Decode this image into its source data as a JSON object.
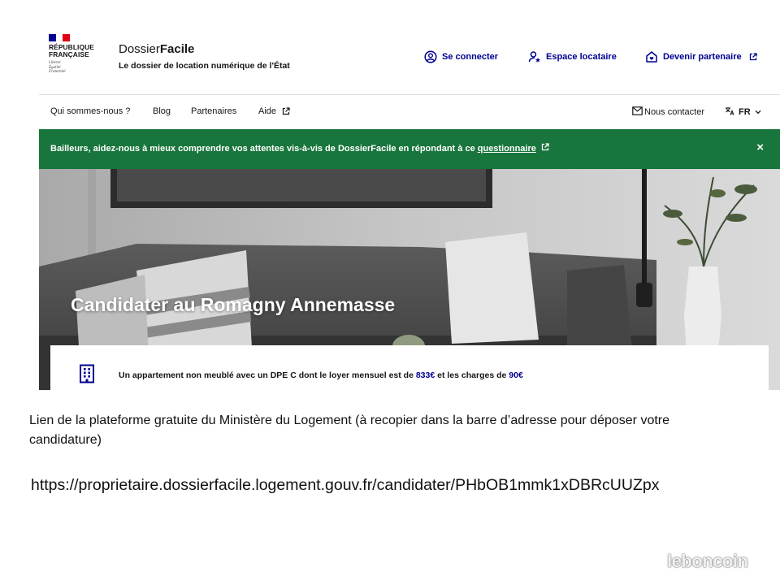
{
  "header": {
    "republique": "RÉPUBLIQUE FRANÇAISE",
    "devise": [
      "Liberté",
      "Égalité",
      "Fraternité"
    ],
    "brand_prefix": "Dossier",
    "brand_bold": "Facile",
    "tagline": "Le dossier de location numérique de l'État",
    "links": {
      "login": "Se connecter",
      "tenant_space": "Espace locataire",
      "partner": "Devenir partenaire"
    }
  },
  "nav": {
    "about": "Qui sommes-nous ?",
    "blog": "Blog",
    "partners": "Partenaires",
    "help": "Aide",
    "contact": "Nous contacter",
    "lang": "FR"
  },
  "banner": {
    "text": "Bailleurs, aidez-nous à mieux comprendre vos attentes vis-à-vis de DossierFacile en répondant à ce",
    "link": "questionnaire",
    "close": "×"
  },
  "hero": {
    "title": "Candidater au Romagny Annemasse"
  },
  "card": {
    "text_before": "Un appartement non meublé avec un DPE C dont le loyer mensuel est de",
    "rent": "833€",
    "text_middle": "et les charges de",
    "charges": "90€"
  },
  "description": "Lien de la plateforme gratuite du Ministère du Logement (à recopier dans la barre d’adresse pour déposer votre candidature)",
  "url": "https://proprietaire.dossierfacile.logement.gouv.fr/candidater/PHbOB1mmk1xDBRcUUZpx",
  "watermark": "leboncoin",
  "colors": {
    "accent": "#000091",
    "banner": "#18753c",
    "marianne_red": "#e1000f"
  }
}
